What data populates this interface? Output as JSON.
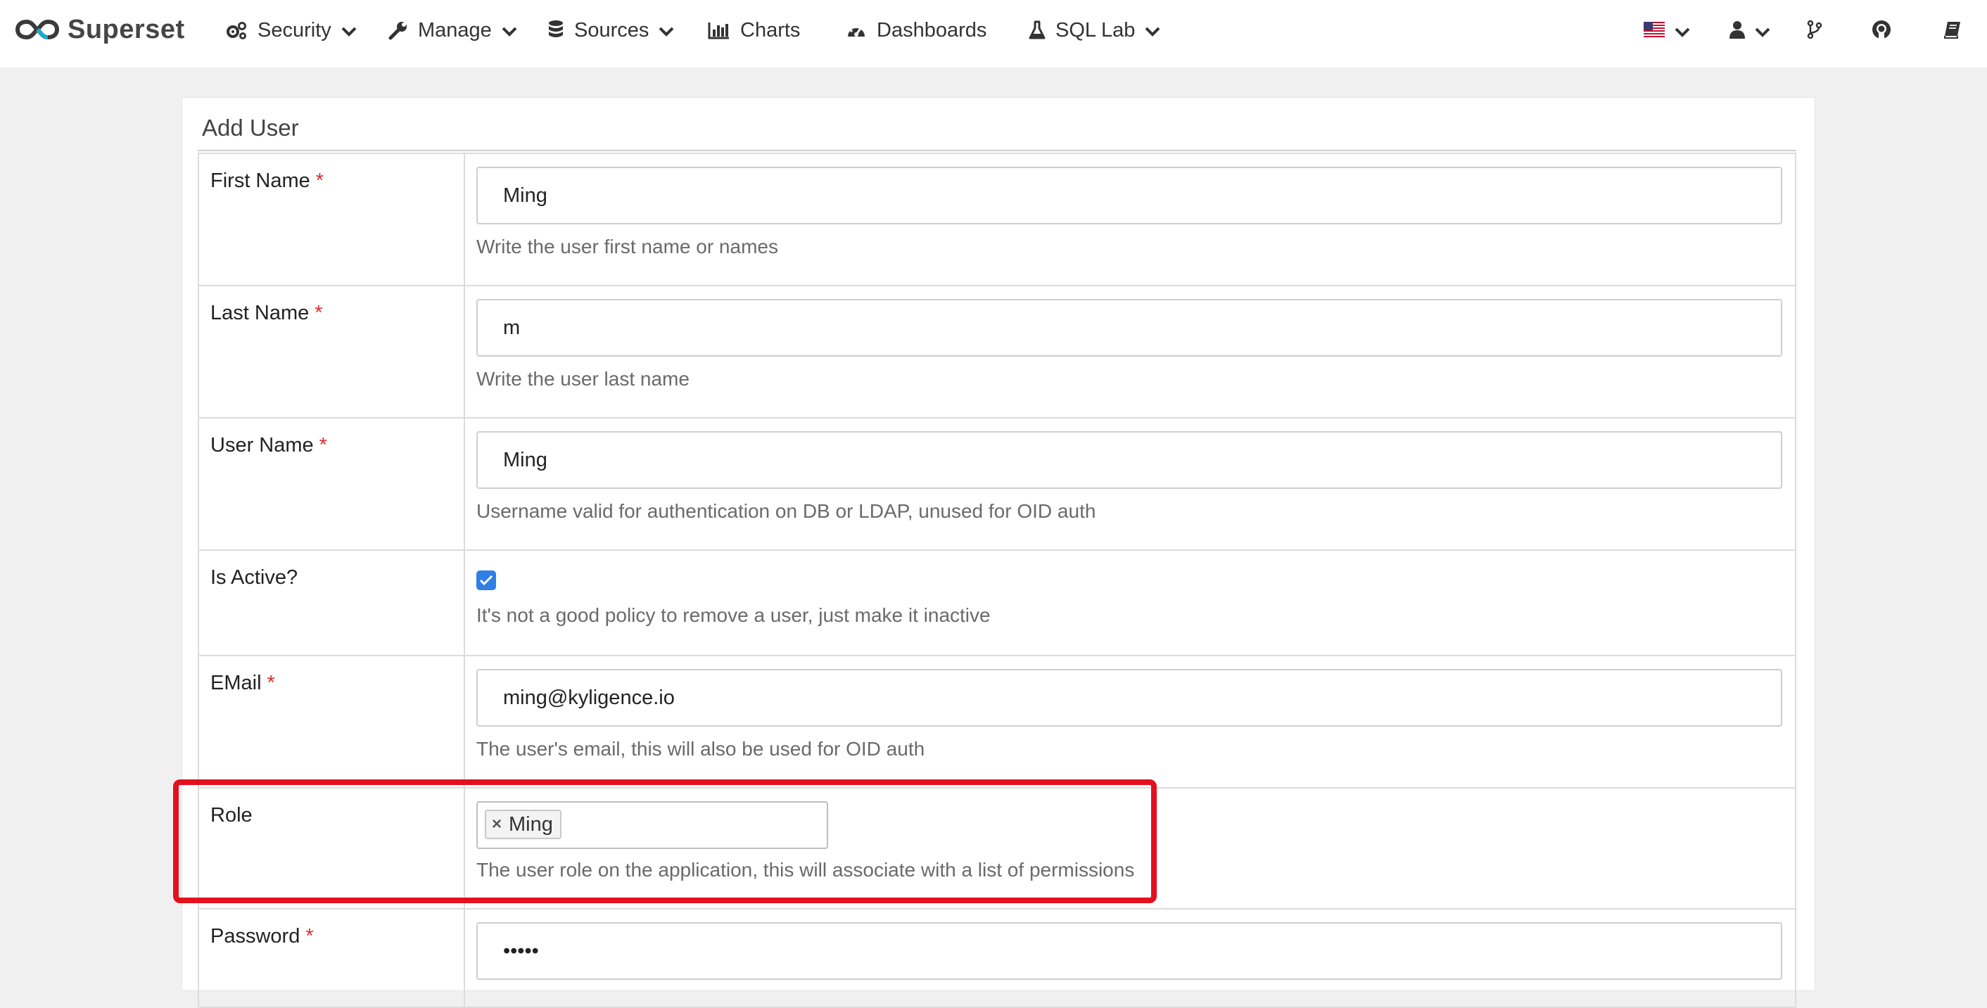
{
  "navbar": {
    "brand": "Superset",
    "items": [
      {
        "label": "Security",
        "has_dropdown": true,
        "icon": "cogs-icon"
      },
      {
        "label": "Manage",
        "has_dropdown": true,
        "icon": "wrench-icon"
      },
      {
        "label": "Sources",
        "has_dropdown": true,
        "icon": "database-icon"
      },
      {
        "label": "Charts",
        "has_dropdown": false,
        "icon": "bar-chart-icon"
      },
      {
        "label": "Dashboards",
        "has_dropdown": false,
        "icon": "dashboard-icon"
      },
      {
        "label": "SQL Lab",
        "has_dropdown": true,
        "icon": "flask-icon"
      }
    ],
    "right_icons": [
      "us-flag-icon",
      "user-icon",
      "git-branch-icon",
      "github-icon",
      "book-icon"
    ]
  },
  "form": {
    "title": "Add User",
    "required_marker": "*",
    "first_name": {
      "label": "First Name",
      "value": "Ming",
      "help": "Write the user first name or names"
    },
    "last_name": {
      "label": "Last Name",
      "value": "m",
      "help": "Write the user last name"
    },
    "user_name": {
      "label": "User Name",
      "value": "Ming",
      "help": "Username valid for authentication on DB or LDAP, unused for OID auth"
    },
    "is_active": {
      "label": "Is Active?",
      "checked": true,
      "help": "It's not a good policy to remove a user, just make it inactive"
    },
    "email": {
      "label": "EMail",
      "value": "ming@kyligence.io",
      "help": "The user's email, this will also be used for OID auth"
    },
    "role": {
      "label": "Role",
      "tag_remove": "×",
      "tag": "Ming",
      "help": "The user role on the application, this will associate with a list of permissions"
    },
    "password": {
      "label": "Password",
      "value": "•••••"
    }
  },
  "colors": {
    "highlight": "#e3101d",
    "checkbox": "#2f7fe6",
    "required": "#d9302e"
  }
}
